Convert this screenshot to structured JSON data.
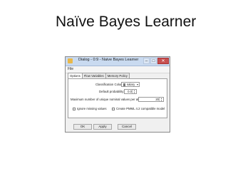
{
  "slide": {
    "title": "Naïve Bayes Learner"
  },
  "dialog": {
    "title": "Dialog - 0:9 - Naive Bayes Learner",
    "menu": {
      "file": "File"
    },
    "tabs": [
      "Options",
      "Flow Variables",
      "Memory Policy"
    ],
    "options": {
      "classification_label": "Classification Column:",
      "classification_value": "salary",
      "default_probability_label": "Default probability:",
      "default_probability_value": "0.0",
      "max_unique_label": "Maximum number of unique nominal values per attribute:",
      "max_unique_value": "20",
      "ignore_missing_label": "Ignore missing values",
      "pmml_label": "Create PMML 4.2 compatible model"
    },
    "buttons": {
      "ok": "OK",
      "apply": "Apply",
      "cancel": "Cancel"
    }
  }
}
